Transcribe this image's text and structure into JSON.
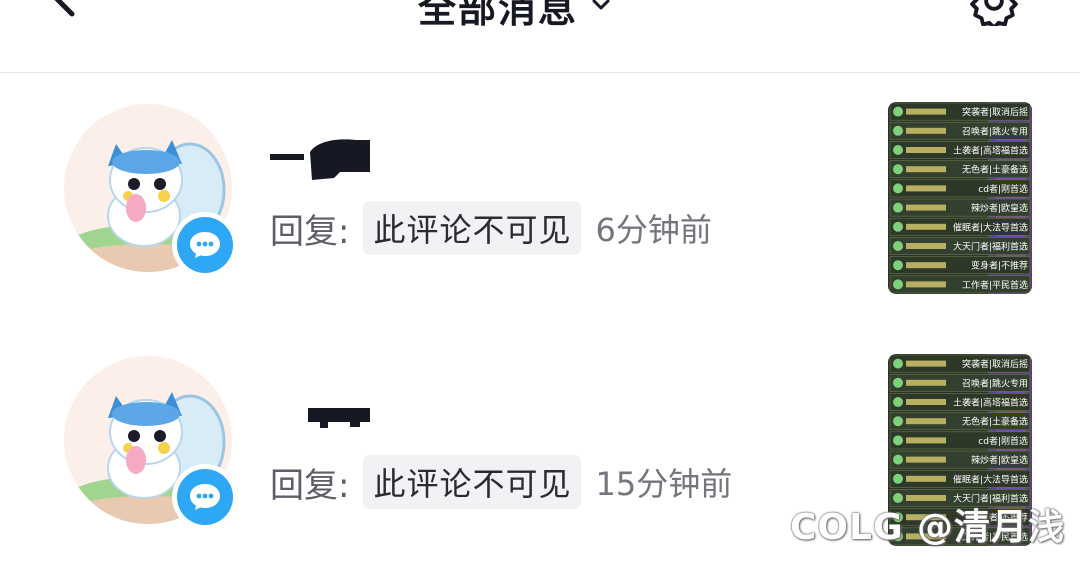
{
  "header": {
    "title": "全部消息",
    "back_icon": "chevron-left-icon",
    "title_icon": "chevron-down-icon",
    "settings_icon": "gear-icon"
  },
  "notifications": [
    {
      "reply_prefix": "回复:",
      "comment_text": "此评论不可见",
      "time": "6分钟前",
      "badge_icon": "comment-bubble-icon"
    },
    {
      "reply_prefix": "回复:",
      "comment_text": "此评论不可见",
      "time": "15分钟前",
      "badge_icon": "comment-bubble-icon"
    }
  ],
  "thumbnail": {
    "lines": [
      "突袭者|取消后摇",
      "召唤者|跳火专用",
      "土袭者|高塔福首选",
      "无色者|土豪备选",
      "cd者|刚首选",
      "辣炒者|欧皇选",
      "催眠者|大法导首选",
      "大天门者|福利首选",
      "变身者|不推荐",
      "工作者|平民首选"
    ]
  },
  "watermark": "COLG @清月浅",
  "colors": {
    "accent_blue": "#2ea7f5",
    "pill_bg": "#f2f2f4",
    "text_primary": "#161823",
    "text_secondary": "#75757d"
  }
}
